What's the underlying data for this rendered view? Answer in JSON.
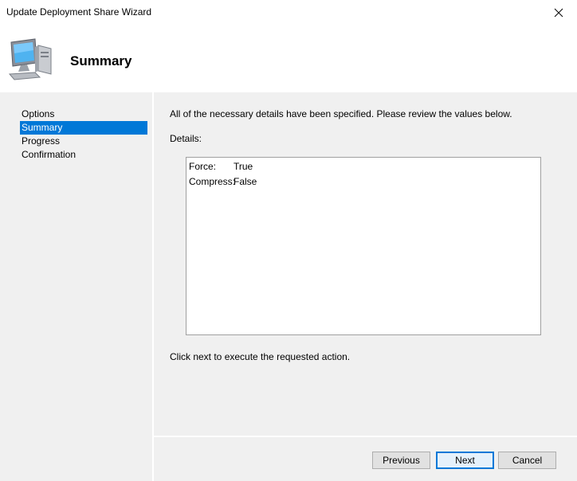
{
  "window": {
    "title": "Update Deployment Share Wizard",
    "close_icon": "close-icon"
  },
  "header": {
    "icon": "computer-icon",
    "heading": "Summary"
  },
  "sidebar": {
    "items": [
      {
        "label": "Options",
        "selected": false
      },
      {
        "label": "Summary",
        "selected": true
      },
      {
        "label": "Progress",
        "selected": false
      },
      {
        "label": "Confirmation",
        "selected": false
      }
    ]
  },
  "main": {
    "intro": "All of the necessary details have been specified.  Please review the values below.",
    "details_label": "Details:",
    "details": [
      {
        "key": "Force:",
        "value": "True"
      },
      {
        "key": "Compress:",
        "value": "False"
      }
    ],
    "hint": "Click next to execute the requested action."
  },
  "buttons": {
    "previous": "Previous",
    "next": "Next",
    "cancel": "Cancel"
  },
  "colors": {
    "accent": "#0078d7",
    "panel_bg": "#f0f0f0"
  }
}
